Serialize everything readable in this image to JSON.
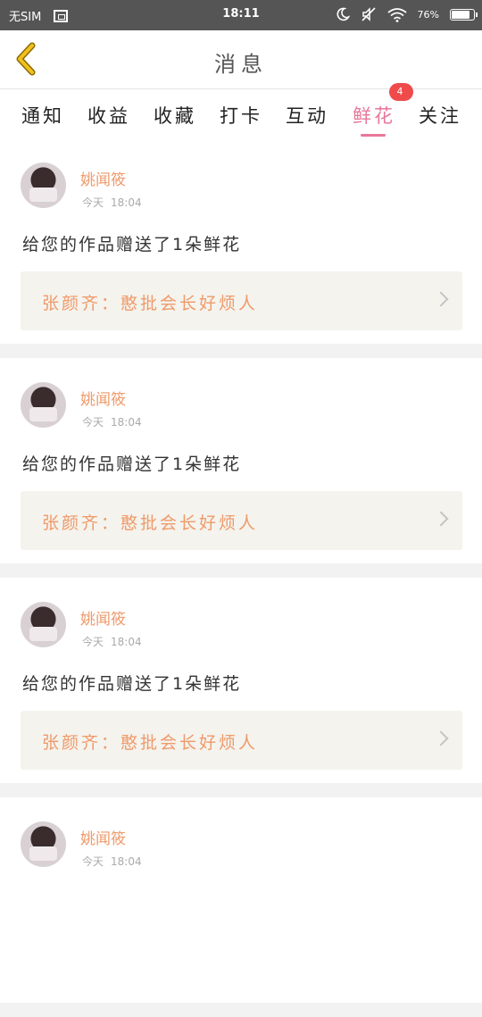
{
  "status_bar": {
    "carrier": "无SIM",
    "time": "18:11",
    "battery": "76"
  },
  "header": {
    "title": "消息"
  },
  "tabs": [
    {
      "label": "通知"
    },
    {
      "label": "收益"
    },
    {
      "label": "收藏"
    },
    {
      "label": "打卡"
    },
    {
      "label": "互动"
    },
    {
      "label": "鲜花",
      "badge": "4",
      "active": true
    },
    {
      "label": "关注"
    }
  ],
  "feed": [
    {
      "user": "姚闻筱",
      "date": "今天",
      "time": "18:04",
      "message": "给您的作品赠送了1朵鲜花",
      "work": "张颜齐：憨批会长好烦人"
    },
    {
      "user": "姚闻筱",
      "date": "今天",
      "time": "18:04",
      "message": "给您的作品赠送了1朵鲜花",
      "work": "张颜齐：憨批会长好烦人"
    },
    {
      "user": "姚闻筱",
      "date": "今天",
      "time": "18:04",
      "message": "给您的作品赠送了1朵鲜花",
      "work": "张颜齐：憨批会长好烦人"
    },
    {
      "user": "姚闻筱",
      "date": "今天",
      "time": "18:04"
    }
  ],
  "colors": {
    "accent_pink": "#e8779a",
    "accent_orange": "#ee9a6b",
    "badge_red": "#f04b4b",
    "back_yellow": "#f0c020"
  },
  "icons": [
    "back-arrow-icon",
    "screenshot-icon",
    "moon-icon",
    "mute-icon",
    "wifi-icon",
    "battery-icon",
    "chevron-right-icon"
  ]
}
